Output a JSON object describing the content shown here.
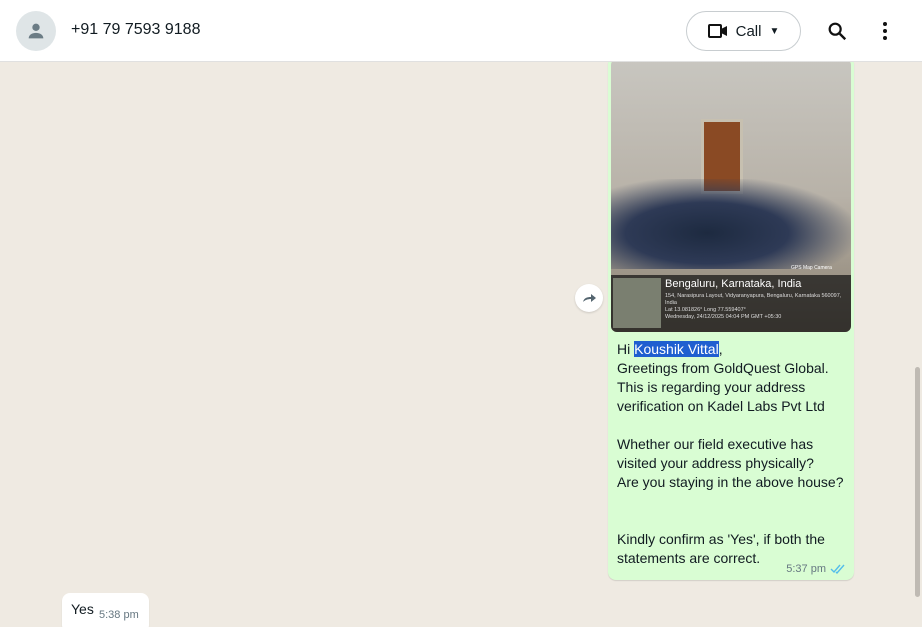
{
  "header": {
    "contact": "+91 79 7593 9188",
    "call_label": "Call"
  },
  "messages": [
    {
      "direction": "out",
      "image": {
        "location_title": "Bengaluru, Karnataka, India",
        "address": "154, Narasipura Layout, Vidyaranyapura, Bengaluru, Karnataka 560097, India",
        "coords": "Lat 13.081826° Long 77.559407°",
        "datetime": "Wednesday, 24/12/2025 04:04 PM GMT +05:30",
        "watermark": "GPS Map Camera"
      },
      "greeting": "Hi ",
      "highlight": "Koushik Vittal",
      "after": ",",
      "body": "Greetings from GoldQuest Global.\nThis is regarding your address verification on Kadel Labs Pvt Ltd\n\nWhether our field executive has visited your address physically?\nAre you staying in the above house?\n\n\nKindly confirm as 'Yes', if both the statements are correct.",
      "time": "5:37 pm"
    },
    {
      "direction": "in",
      "text": "Yes",
      "time": "5:38 pm"
    }
  ]
}
